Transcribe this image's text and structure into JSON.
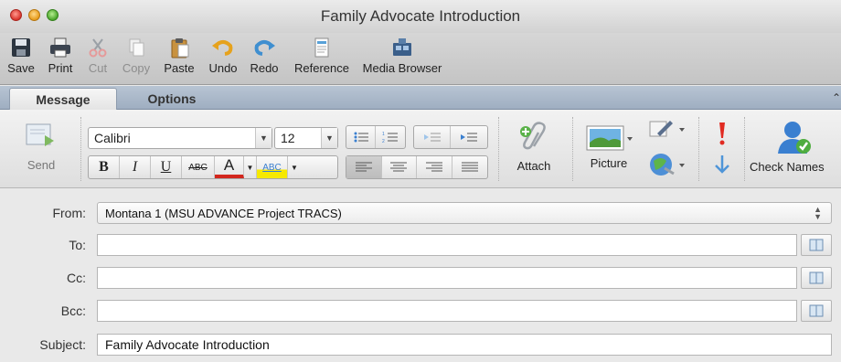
{
  "window": {
    "title": "Family Advocate Introduction"
  },
  "toolbar": {
    "buttons": [
      {
        "label": "Save",
        "icon": "floppy-icon",
        "enabled": true
      },
      {
        "label": "Print",
        "icon": "printer-icon",
        "enabled": true
      },
      {
        "label": "Cut",
        "icon": "scissors-icon",
        "enabled": false
      },
      {
        "label": "Copy",
        "icon": "copy-icon",
        "enabled": false
      },
      {
        "label": "Paste",
        "icon": "clipboard-icon",
        "enabled": true
      },
      {
        "label": "Undo",
        "icon": "undo-icon",
        "enabled": true
      },
      {
        "label": "Redo",
        "icon": "redo-icon",
        "enabled": true
      },
      {
        "label": "Reference",
        "icon": "reference-icon",
        "enabled": true
      },
      {
        "label": "Media Browser",
        "icon": "media-browser-icon",
        "enabled": true
      }
    ]
  },
  "tabs": [
    {
      "label": "Message",
      "active": true
    },
    {
      "label": "Options",
      "active": false
    }
  ],
  "ribbon": {
    "send_label": "Send",
    "font_name": "Calibri",
    "font_size": "12",
    "format_buttons": [
      "B",
      "I",
      "U",
      "ABC",
      "A",
      "ABC"
    ],
    "attach_label": "Attach",
    "picture_label": "Picture",
    "check_names_label": "Check Names",
    "colors": {
      "highlight": "#f6e900",
      "font_color": "#d2261d",
      "accent": "#3a7fd0"
    }
  },
  "header": {
    "from_label": "From:",
    "from_value": "Montana 1 (MSU ADVANCE Project TRACS)",
    "to_label": "To:",
    "to_value": "",
    "cc_label": "Cc:",
    "cc_value": "",
    "bcc_label": "Bcc:",
    "bcc_value": "",
    "subject_label": "Subject:",
    "subject_value": "Family Advocate Introduction"
  }
}
